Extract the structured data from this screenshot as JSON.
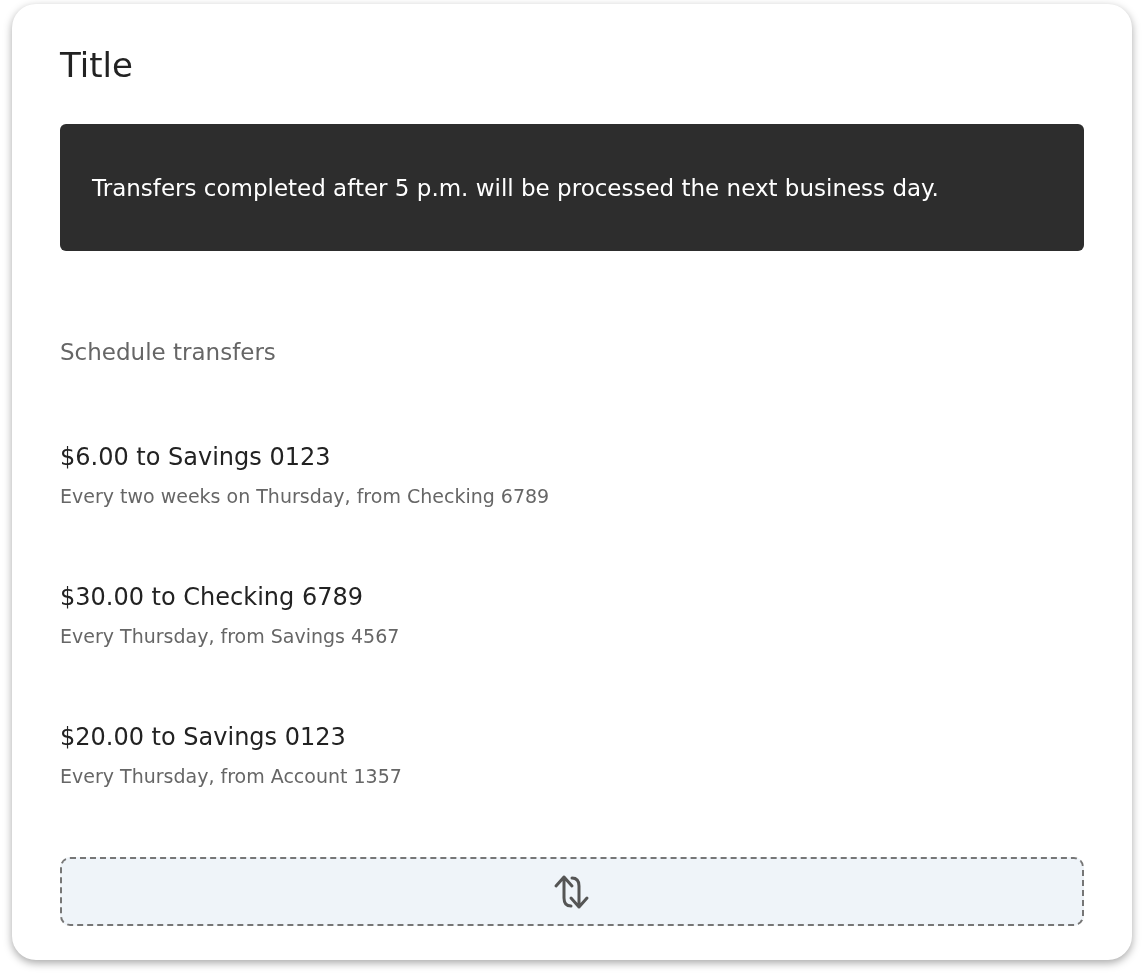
{
  "title": "Title",
  "notice": "Transfers completed after 5 p.m. will be processed the next business day.",
  "section_label": "Schedule transfers",
  "transfers": [
    {
      "title": "$6.00 to Savings 0123",
      "detail": "Every two weeks on Thursday, from Checking 6789"
    },
    {
      "title": "$30.00 to Checking 6789",
      "detail": "Every Thursday, from Savings 4567"
    },
    {
      "title": "$20.00 to Savings 0123",
      "detail": "Every Thursday, from Account 1357"
    }
  ]
}
